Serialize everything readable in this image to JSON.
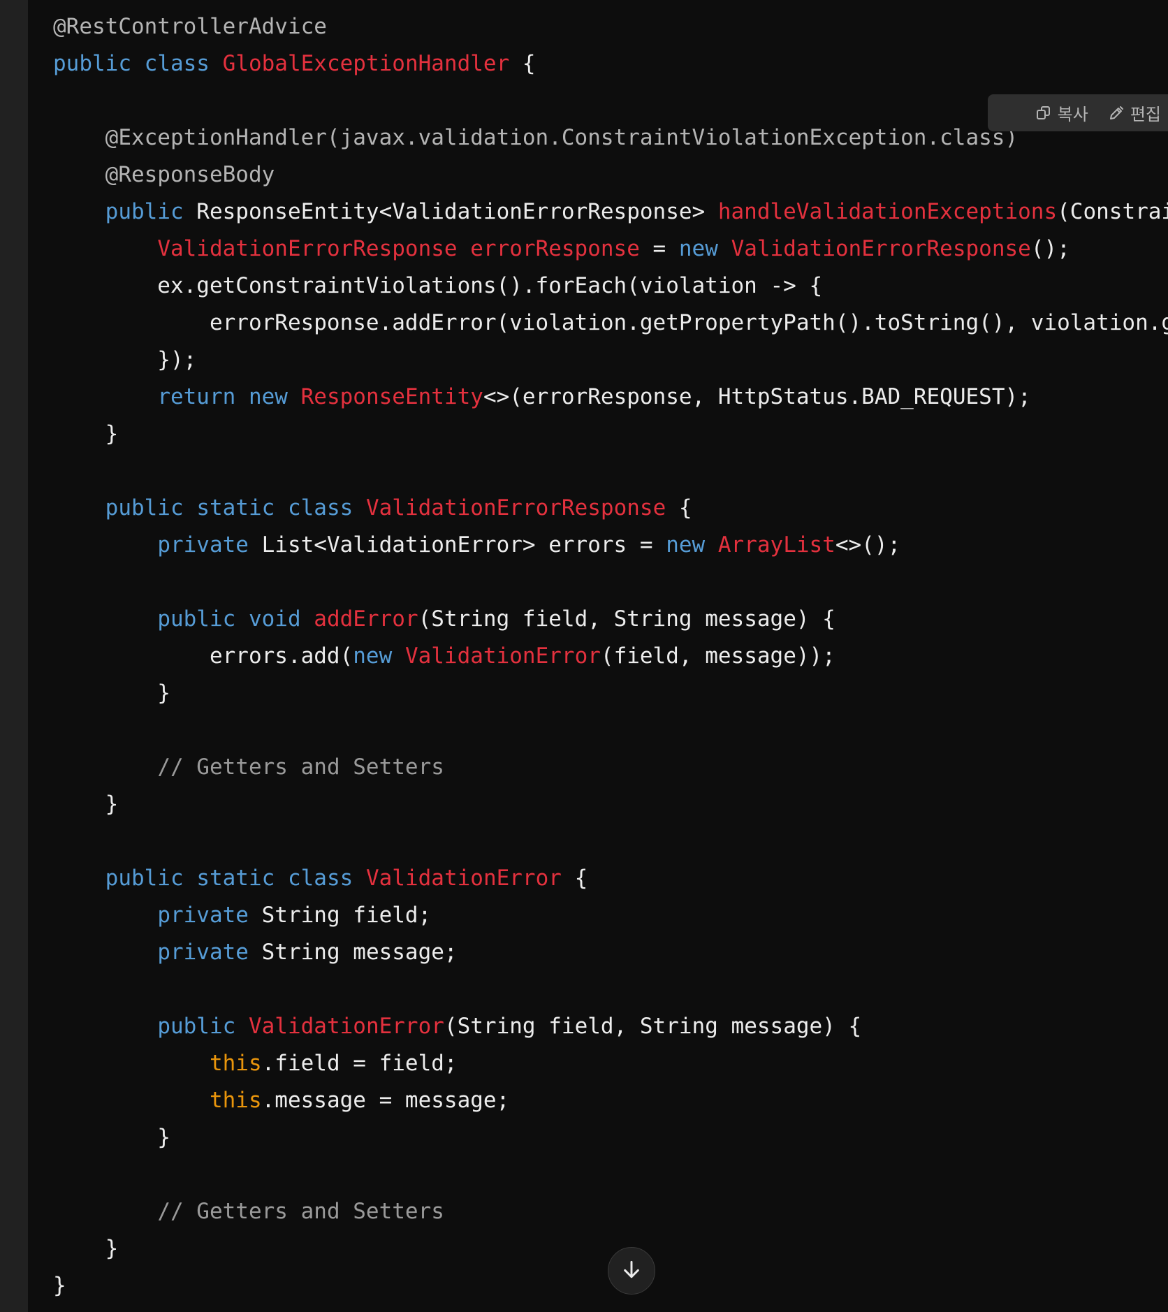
{
  "toolbar": {
    "copy_label": "복사",
    "edit_label": "편집",
    "copy_icon": "copy-icon",
    "edit_icon": "pencil-icon"
  },
  "scroll_button": {
    "icon": "arrow-down-icon"
  },
  "colors": {
    "keyword": "#569cd6",
    "type": "#e4313e",
    "annotation": "#b4b4b4",
    "comment": "#9a9a9a",
    "this": "#e9950c",
    "default": "#ececec",
    "background": "#0d0d0d"
  },
  "code": {
    "language": "java",
    "lines": [
      [
        [
          "annotation",
          "@RestControllerAdvice"
        ]
      ],
      [
        [
          "keyword",
          "public"
        ],
        [
          "default",
          " "
        ],
        [
          "keyword",
          "class"
        ],
        [
          "default",
          " "
        ],
        [
          "type",
          "GlobalExceptionHandler"
        ],
        [
          "default",
          " {"
        ]
      ],
      [],
      [
        [
          "default",
          "    "
        ],
        [
          "annotation",
          "@ExceptionHandler(javax.validation.ConstraintViolationException.class)"
        ]
      ],
      [
        [
          "default",
          "    "
        ],
        [
          "annotation",
          "@ResponseBody"
        ]
      ],
      [
        [
          "default",
          "    "
        ],
        [
          "keyword",
          "public"
        ],
        [
          "default",
          " ResponseEntity<ValidationErrorResponse> "
        ],
        [
          "type",
          "handleValidationExceptions"
        ],
        [
          "default",
          "(Constrai"
        ]
      ],
      [
        [
          "default",
          "        "
        ],
        [
          "type",
          "ValidationErrorResponse"
        ],
        [
          "default",
          " "
        ],
        [
          "type",
          "errorResponse"
        ],
        [
          "default",
          " = "
        ],
        [
          "keyword",
          "new"
        ],
        [
          "default",
          " "
        ],
        [
          "type",
          "ValidationErrorResponse"
        ],
        [
          "default",
          "();"
        ]
      ],
      [
        [
          "default",
          "        ex.getConstraintViolations().forEach(violation -> {"
        ]
      ],
      [
        [
          "default",
          "            errorResponse.addError(violation.getPropertyPath().toString(), violation.g"
        ]
      ],
      [
        [
          "default",
          "        });"
        ]
      ],
      [
        [
          "default",
          "        "
        ],
        [
          "keyword",
          "return"
        ],
        [
          "default",
          " "
        ],
        [
          "keyword",
          "new"
        ],
        [
          "default",
          " "
        ],
        [
          "type",
          "ResponseEntity"
        ],
        [
          "default",
          "<>(errorResponse, HttpStatus.BAD_REQUEST);"
        ]
      ],
      [
        [
          "default",
          "    }"
        ]
      ],
      [],
      [
        [
          "default",
          "    "
        ],
        [
          "keyword",
          "public"
        ],
        [
          "default",
          " "
        ],
        [
          "keyword",
          "static"
        ],
        [
          "default",
          " "
        ],
        [
          "keyword",
          "class"
        ],
        [
          "default",
          " "
        ],
        [
          "type",
          "ValidationErrorResponse"
        ],
        [
          "default",
          " {"
        ]
      ],
      [
        [
          "default",
          "        "
        ],
        [
          "keyword",
          "private"
        ],
        [
          "default",
          " List<ValidationError> errors = "
        ],
        [
          "keyword",
          "new"
        ],
        [
          "default",
          " "
        ],
        [
          "type",
          "ArrayList"
        ],
        [
          "default",
          "<>();"
        ]
      ],
      [],
      [
        [
          "default",
          "        "
        ],
        [
          "keyword",
          "public"
        ],
        [
          "default",
          " "
        ],
        [
          "keyword",
          "void"
        ],
        [
          "default",
          " "
        ],
        [
          "type",
          "addError"
        ],
        [
          "default",
          "(String field, String message) {"
        ]
      ],
      [
        [
          "default",
          "            errors.add("
        ],
        [
          "keyword",
          "new"
        ],
        [
          "default",
          " "
        ],
        [
          "type",
          "ValidationError"
        ],
        [
          "default",
          "(field, message));"
        ]
      ],
      [
        [
          "default",
          "        }"
        ]
      ],
      [],
      [
        [
          "default",
          "        "
        ],
        [
          "comment",
          "// Getters and Setters"
        ]
      ],
      [
        [
          "default",
          "    }"
        ]
      ],
      [],
      [
        [
          "default",
          "    "
        ],
        [
          "keyword",
          "public"
        ],
        [
          "default",
          " "
        ],
        [
          "keyword",
          "static"
        ],
        [
          "default",
          " "
        ],
        [
          "keyword",
          "class"
        ],
        [
          "default",
          " "
        ],
        [
          "type",
          "ValidationError"
        ],
        [
          "default",
          " {"
        ]
      ],
      [
        [
          "default",
          "        "
        ],
        [
          "keyword",
          "private"
        ],
        [
          "default",
          " String field;"
        ]
      ],
      [
        [
          "default",
          "        "
        ],
        [
          "keyword",
          "private"
        ],
        [
          "default",
          " String message;"
        ]
      ],
      [],
      [
        [
          "default",
          "        "
        ],
        [
          "keyword",
          "public"
        ],
        [
          "default",
          " "
        ],
        [
          "type",
          "ValidationError"
        ],
        [
          "default",
          "(String field, String message) {"
        ]
      ],
      [
        [
          "default",
          "            "
        ],
        [
          "this",
          "this"
        ],
        [
          "default",
          ".field = field;"
        ]
      ],
      [
        [
          "default",
          "            "
        ],
        [
          "this",
          "this"
        ],
        [
          "default",
          ".message = message;"
        ]
      ],
      [
        [
          "default",
          "        }"
        ]
      ],
      [],
      [
        [
          "default",
          "        "
        ],
        [
          "comment",
          "// Getters and Setters"
        ]
      ],
      [
        [
          "default",
          "    }"
        ]
      ],
      [
        [
          "default",
          "}"
        ]
      ]
    ]
  }
}
